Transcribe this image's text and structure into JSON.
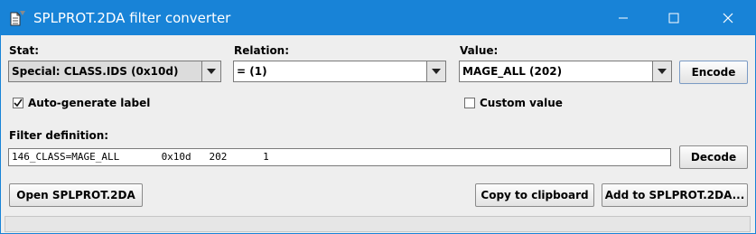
{
  "window": {
    "title": "SPLPROT.2DA filter converter",
    "accent_color": "#1883d7",
    "controls": {
      "minimize_icon": "minimize-icon",
      "maximize_icon": "maximize-icon",
      "close_icon": "close-icon"
    }
  },
  "stat": {
    "label": "Stat:",
    "selected": "Special: CLASS.IDS (0x10d)"
  },
  "relation": {
    "label": "Relation:",
    "selected": "= (1)"
  },
  "value": {
    "label": "Value:",
    "selected": "MAGE_ALL (202)"
  },
  "encode_button": "Encode",
  "auto_label_checkbox": {
    "label": "Auto-generate label",
    "checked": true
  },
  "custom_value_checkbox": {
    "label": "Custom value",
    "checked": false
  },
  "filter": {
    "label": "Filter definition:",
    "value": "146_CLASS=MAGE_ALL       0x10d   202      1"
  },
  "decode_button": "Decode",
  "open_button": "Open SPLPROT.2DA",
  "copy_button": "Copy to clipboard",
  "add_button": "Add to SPLPROT.2DA..."
}
